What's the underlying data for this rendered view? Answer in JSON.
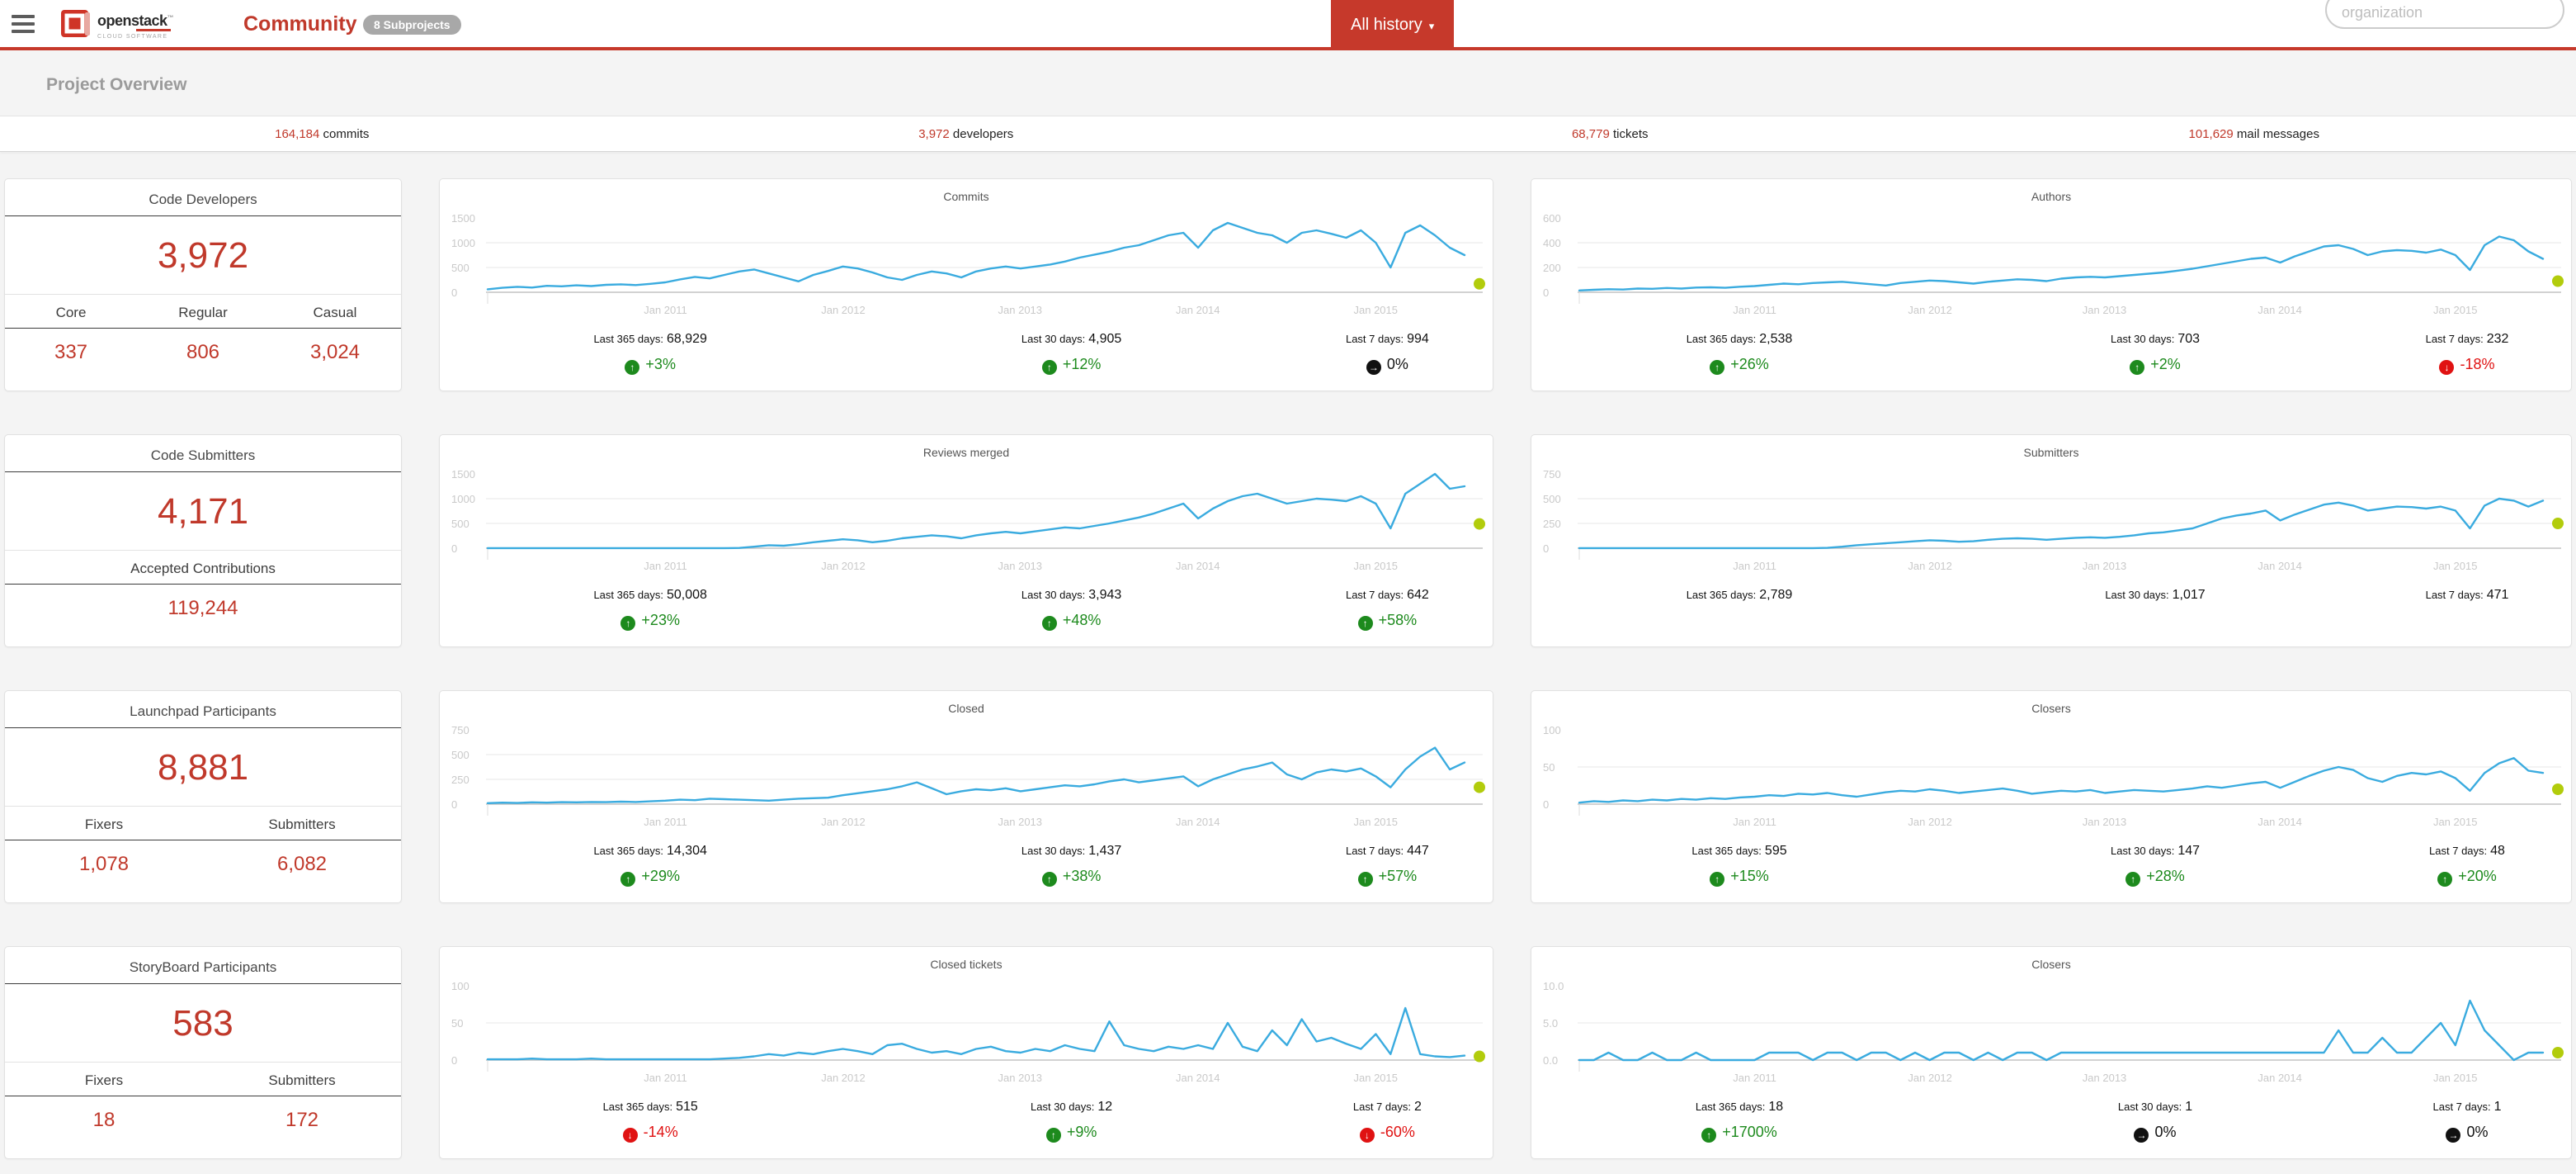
{
  "colors": {
    "accent": "#c0392b",
    "line": "#3aabdf",
    "dot": "#b2cc0c",
    "up": "#1d8a1d",
    "down": "#e01212",
    "flat": "#111111",
    "grid": "#e7e7e7",
    "axis": "#c4c4c4",
    "tick_label": "#c9c9c9"
  },
  "header": {
    "brand": "openstack",
    "brand_tm": "™",
    "brand_sub": "CLOUD SOFTWARE",
    "title": "Community",
    "badge": "8 Subprojects",
    "range_button": "All history",
    "search_placeholder": "organization"
  },
  "page": {
    "section_title": "Project Overview"
  },
  "summary": [
    {
      "value": "164,184",
      "label": "commits"
    },
    {
      "value": "3,972",
      "label": "developers"
    },
    {
      "value": "68,779",
      "label": "tickets"
    },
    {
      "value": "101,629",
      "label": "mail messages"
    }
  ],
  "stat_cards": [
    {
      "title": "Code Developers",
      "big": "3,972",
      "columns": [
        {
          "label": "Core",
          "value": "337"
        },
        {
          "label": "Regular",
          "value": "806"
        },
        {
          "label": "Casual",
          "value": "3,024"
        }
      ]
    },
    {
      "title": "Code Submitters",
      "big": "4,171",
      "columns": [
        {
          "label": "Accepted Contributions",
          "value": "119,244"
        }
      ]
    },
    {
      "title": "Launchpad Participants",
      "big": "8,881",
      "columns": [
        {
          "label": "Fixers",
          "value": "1,078"
        },
        {
          "label": "Submitters",
          "value": "6,082"
        }
      ]
    },
    {
      "title": "StoryBoard Participants",
      "big": "583",
      "columns": [
        {
          "label": "Fixers",
          "value": "18"
        },
        {
          "label": "Submitters",
          "value": "172"
        }
      ]
    }
  ],
  "x_axis": {
    "ticks": [
      {
        "label": "Jan 2011",
        "pos": 0.182
      },
      {
        "label": "Jan 2012",
        "pos": 0.364
      },
      {
        "label": "Jan 2013",
        "pos": 0.545
      },
      {
        "label": "Jan 2014",
        "pos": 0.727
      },
      {
        "label": "Jan 2015",
        "pos": 0.909
      }
    ]
  },
  "chart_data": [
    {
      "type": "line",
      "title": "Commits",
      "x_range": [
        "Jan 2010",
        "Jul 2015"
      ],
      "y_ticks": [
        "0",
        "500",
        "1000",
        "1500"
      ],
      "ylim": [
        0,
        1500
      ],
      "current_point": 170,
      "values": [
        60,
        90,
        110,
        95,
        130,
        120,
        140,
        125,
        150,
        160,
        145,
        170,
        200,
        260,
        310,
        280,
        350,
        420,
        460,
        380,
        300,
        220,
        350,
        430,
        520,
        480,
        400,
        300,
        250,
        350,
        420,
        380,
        300,
        420,
        480,
        520,
        480,
        520,
        560,
        620,
        700,
        760,
        820,
        900,
        950,
        1050,
        1150,
        1200,
        900,
        1250,
        1400,
        1300,
        1200,
        1150,
        1000,
        1200,
        1250,
        1180,
        1100,
        1250,
        1000,
        500,
        1200,
        1350,
        1150,
        900,
        750
      ],
      "stats": [
        {
          "label": "Last 365 days:",
          "value": "68,929",
          "change": "+3%",
          "direction": "up"
        },
        {
          "label": "Last 30 days:",
          "value": "4,905",
          "change": "+12%",
          "direction": "up"
        },
        {
          "label": "Last 7 days:",
          "value": "994",
          "change": "0%",
          "direction": "flat"
        }
      ]
    },
    {
      "type": "line",
      "title": "Authors",
      "x_range": [
        "Jan 2010",
        "Jul 2015"
      ],
      "y_ticks": [
        "0",
        "200",
        "400",
        "600"
      ],
      "ylim": [
        0,
        600
      ],
      "current_point": 90,
      "values": [
        15,
        20,
        25,
        22,
        30,
        28,
        35,
        30,
        38,
        40,
        36,
        45,
        50,
        60,
        70,
        65,
        75,
        80,
        85,
        75,
        65,
        55,
        75,
        85,
        95,
        90,
        80,
        70,
        85,
        95,
        105,
        100,
        90,
        110,
        120,
        125,
        120,
        130,
        140,
        150,
        160,
        175,
        190,
        210,
        230,
        250,
        270,
        280,
        240,
        290,
        330,
        370,
        380,
        350,
        300,
        330,
        340,
        335,
        320,
        345,
        300,
        180,
        380,
        450,
        420,
        330,
        270
      ],
      "stats": [
        {
          "label": "Last 365 days:",
          "value": "2,538",
          "change": "+26%",
          "direction": "up"
        },
        {
          "label": "Last 30 days:",
          "value": "703",
          "change": "+2%",
          "direction": "up"
        },
        {
          "label": "Last 7 days:",
          "value": "232",
          "change": "-18%",
          "direction": "down"
        }
      ]
    },
    {
      "type": "line",
      "title": "Reviews merged",
      "x_range": [
        "Jan 2010",
        "Jul 2015"
      ],
      "y_ticks": [
        "0",
        "500",
        "1000",
        "1500"
      ],
      "ylim": [
        0,
        1500
      ],
      "current_point": 490,
      "values": [
        2,
        2,
        2,
        2,
        2,
        2,
        2,
        2,
        2,
        2,
        2,
        2,
        2,
        2,
        2,
        2,
        2,
        5,
        30,
        60,
        50,
        80,
        120,
        150,
        180,
        160,
        120,
        150,
        200,
        230,
        260,
        240,
        200,
        260,
        300,
        330,
        300,
        340,
        380,
        420,
        400,
        450,
        500,
        560,
        620,
        700,
        800,
        900,
        600,
        800,
        950,
        1050,
        1100,
        1000,
        900,
        950,
        1000,
        980,
        950,
        1050,
        900,
        400,
        1100,
        1300,
        1500,
        1200,
        1250
      ],
      "stats": [
        {
          "label": "Last 365 days:",
          "value": "50,008",
          "change": "+23%",
          "direction": "up"
        },
        {
          "label": "Last 30 days:",
          "value": "3,943",
          "change": "+48%",
          "direction": "up"
        },
        {
          "label": "Last 7 days:",
          "value": "642",
          "change": "+58%",
          "direction": "up"
        }
      ]
    },
    {
      "type": "line",
      "title": "Submitters",
      "x_range": [
        "Jan 2010",
        "Jul 2015"
      ],
      "y_ticks": [
        "0",
        "250",
        "500",
        "750"
      ],
      "ylim": [
        0,
        750
      ],
      "current_point": 250,
      "values": [
        1,
        1,
        1,
        1,
        1,
        1,
        1,
        1,
        1,
        1,
        1,
        1,
        1,
        1,
        1,
        1,
        1,
        3,
        15,
        30,
        40,
        50,
        60,
        70,
        80,
        75,
        65,
        70,
        85,
        95,
        100,
        95,
        85,
        95,
        105,
        110,
        105,
        115,
        130,
        150,
        160,
        180,
        200,
        250,
        300,
        330,
        350,
        380,
        280,
        340,
        390,
        440,
        460,
        430,
        380,
        400,
        420,
        415,
        400,
        420,
        380,
        200,
        430,
        500,
        480,
        420,
        480
      ],
      "stats": [
        {
          "label": "Last 365 days:",
          "value": "2,789"
        },
        {
          "label": "Last 30 days:",
          "value": "1,017"
        },
        {
          "label": "Last 7 days:",
          "value": "471"
        }
      ]
    },
    {
      "type": "line",
      "title": "Closed",
      "x_range": [
        "Jan 2010",
        "Jul 2015"
      ],
      "y_ticks": [
        "0",
        "250",
        "500",
        "750"
      ],
      "ylim": [
        0,
        750
      ],
      "current_point": 170,
      "values": [
        10,
        15,
        12,
        18,
        15,
        20,
        18,
        22,
        20,
        25,
        22,
        28,
        35,
        45,
        40,
        55,
        50,
        45,
        40,
        35,
        45,
        55,
        60,
        65,
        90,
        110,
        130,
        150,
        180,
        220,
        160,
        100,
        130,
        150,
        140,
        160,
        130,
        150,
        170,
        190,
        180,
        200,
        230,
        250,
        220,
        240,
        260,
        280,
        180,
        250,
        300,
        350,
        380,
        420,
        300,
        250,
        320,
        350,
        330,
        360,
        280,
        170,
        350,
        480,
        570,
        350,
        420
      ],
      "stats": [
        {
          "label": "Last 365 days:",
          "value": "14,304",
          "change": "+29%",
          "direction": "up"
        },
        {
          "label": "Last 30 days:",
          "value": "1,437",
          "change": "+38%",
          "direction": "up"
        },
        {
          "label": "Last 7 days:",
          "value": "447",
          "change": "+57%",
          "direction": "up"
        }
      ]
    },
    {
      "type": "line",
      "title": "Closers",
      "x_range": [
        "Jan 2010",
        "Jul 2015"
      ],
      "y_ticks": [
        "0",
        "50",
        "100"
      ],
      "ylim": [
        0,
        100
      ],
      "current_point": 20,
      "values": [
        2,
        4,
        3,
        5,
        4,
        6,
        5,
        7,
        6,
        8,
        7,
        9,
        10,
        12,
        11,
        14,
        13,
        15,
        12,
        10,
        13,
        16,
        18,
        17,
        20,
        18,
        15,
        17,
        19,
        21,
        18,
        14,
        16,
        18,
        17,
        19,
        15,
        17,
        19,
        18,
        17,
        19,
        21,
        24,
        22,
        25,
        28,
        30,
        22,
        30,
        38,
        45,
        50,
        46,
        35,
        30,
        38,
        42,
        40,
        44,
        35,
        18,
        42,
        55,
        62,
        45,
        42
      ],
      "stats": [
        {
          "label": "Last 365 days:",
          "value": "595",
          "change": "+15%",
          "direction": "up"
        },
        {
          "label": "Last 30 days:",
          "value": "147",
          "change": "+28%",
          "direction": "up"
        },
        {
          "label": "Last 7 days:",
          "value": "48",
          "change": "+20%",
          "direction": "up"
        }
      ]
    },
    {
      "type": "line",
      "title": "Closed tickets",
      "x_range": [
        "Jan 2010",
        "Jul 2015"
      ],
      "y_ticks": [
        "0",
        "50",
        "100"
      ],
      "ylim": [
        0,
        100
      ],
      "current_point": 5,
      "values": [
        1,
        1,
        1,
        2,
        1,
        1,
        1,
        2,
        1,
        1,
        1,
        1,
        1,
        1,
        1,
        1,
        2,
        3,
        5,
        8,
        6,
        10,
        8,
        12,
        15,
        12,
        8,
        20,
        22,
        15,
        10,
        12,
        8,
        15,
        18,
        12,
        10,
        15,
        12,
        20,
        15,
        12,
        52,
        20,
        15,
        12,
        18,
        15,
        20,
        15,
        50,
        18,
        12,
        40,
        20,
        55,
        25,
        30,
        22,
        15,
        35,
        8,
        70,
        8,
        5,
        4,
        6
      ],
      "stats": [
        {
          "label": "Last 365 days:",
          "value": "515",
          "change": "-14%",
          "direction": "down"
        },
        {
          "label": "Last 30 days:",
          "value": "12",
          "change": "+9%",
          "direction": "up"
        },
        {
          "label": "Last 7 days:",
          "value": "2",
          "change": "-60%",
          "direction": "down"
        }
      ]
    },
    {
      "type": "line",
      "title": "Closers",
      "x_range": [
        "Jan 2010",
        "Jul 2015"
      ],
      "y_ticks": [
        "0.0",
        "5.0",
        "10.0"
      ],
      "ylim": [
        0,
        10
      ],
      "current_point": 1,
      "values": [
        0,
        0,
        1,
        0,
        0,
        1,
        0,
        0,
        1,
        0,
        0,
        0,
        0,
        1,
        1,
        1,
        0,
        1,
        1,
        0,
        1,
        1,
        0,
        1,
        0,
        1,
        1,
        0,
        1,
        0,
        1,
        1,
        0,
        1,
        1,
        1,
        1,
        1,
        1,
        1,
        1,
        1,
        1,
        1,
        1,
        1,
        1,
        1,
        1,
        1,
        1,
        1,
        4,
        1,
        1,
        3,
        1,
        1,
        3,
        5,
        2,
        8,
        4,
        2,
        0,
        1,
        1
      ],
      "stats": [
        {
          "label": "Last 365 days:",
          "value": "18",
          "change": "+1700%",
          "direction": "up"
        },
        {
          "label": "Last 30 days:",
          "value": "1",
          "change": "0%",
          "direction": "flat"
        },
        {
          "label": "Last 7 days:",
          "value": "1",
          "change": "0%",
          "direction": "flat"
        }
      ]
    }
  ]
}
